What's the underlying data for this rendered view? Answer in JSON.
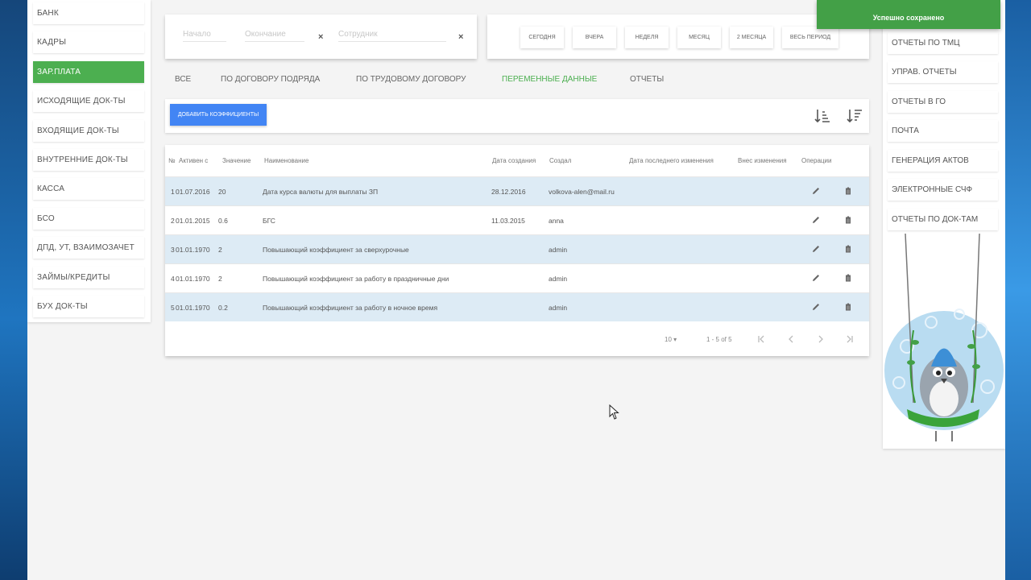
{
  "left_nav": {
    "items": [
      {
        "label": "Банк",
        "active": false
      },
      {
        "label": "Кадры",
        "active": false
      },
      {
        "label": "Зар.плата",
        "active": true
      },
      {
        "label": "Исходящие док-ты",
        "active": false
      },
      {
        "label": "Входящие док-ты",
        "active": false
      },
      {
        "label": "Внутренние док-ты",
        "active": false
      },
      {
        "label": "Касса",
        "active": false
      },
      {
        "label": "БСО",
        "active": false
      },
      {
        "label": "ДПД, УТ, Взаимозачет",
        "active": false
      },
      {
        "label": "Займы/Кредиты",
        "active": false
      },
      {
        "label": "Бух док-ты",
        "active": false
      }
    ]
  },
  "filters": {
    "start_placeholder": "Начало",
    "end_placeholder": "Окончание",
    "employee_placeholder": "Сотрудник",
    "clear_symbol": "×"
  },
  "periods": [
    "Сегодня",
    "Вчера",
    "Неделя",
    "Месяц",
    "2 месяца",
    "Весь период"
  ],
  "tabs": [
    {
      "label": "Все",
      "active": false
    },
    {
      "label": "По договору подряда",
      "active": false
    },
    {
      "label": "По трудовому договору",
      "active": false
    },
    {
      "label": "Переменные данные",
      "active": true
    },
    {
      "label": "Отчеты",
      "active": false
    }
  ],
  "toolbar": {
    "add_label": "Добавить коэффициенты"
  },
  "table": {
    "headers": {
      "num": "№",
      "active_from": "Активен с",
      "value": "Значение",
      "name": "Наименование",
      "created": "Дата создания",
      "creator": "Создал",
      "last_modified": "Дата последнего изменения",
      "modified_by": "Внес изменения",
      "operations": "Операции"
    },
    "rows": [
      {
        "num": "1",
        "active_from": "01.07.2016",
        "value": "20",
        "name": "Дата курса валюты для выплаты ЗП",
        "created": "28.12.2016",
        "creator": "volkova-alen@mail.ru"
      },
      {
        "num": "2",
        "active_from": "01.01.2015",
        "value": "0.6",
        "name": "БГС",
        "created": "11.03.2015",
        "creator": "anna"
      },
      {
        "num": "3",
        "active_from": "01.01.1970",
        "value": "2",
        "name": "Повышающий коэффициент за сверхурочные",
        "created": "",
        "creator": "admin"
      },
      {
        "num": "4",
        "active_from": "01.01.1970",
        "value": "2",
        "name": "Повышающий коэффициент за работу в праздничные дни",
        "created": "",
        "creator": "admin"
      },
      {
        "num": "5",
        "active_from": "01.01.1970",
        "value": "0.2",
        "name": "Повышающий коэффициент за работу в ночное время",
        "created": "",
        "creator": "admin"
      }
    ],
    "pagination": {
      "page_size": "10",
      "range": "1 - 5 of 5"
    }
  },
  "right_nav": {
    "items": [
      "Отчеты по ТМЦ",
      "Управ. отчеты",
      "Отчеты в ГО",
      "Почта",
      "Генерация актов",
      "Электронные СЧФ",
      "Отчеты по док-там"
    ]
  },
  "toast": {
    "message": "Успешно сохранено"
  },
  "colors": {
    "accent_green": "#4caf50",
    "primary_blue": "#4285f4",
    "row_highlight": "#ddebf5"
  }
}
